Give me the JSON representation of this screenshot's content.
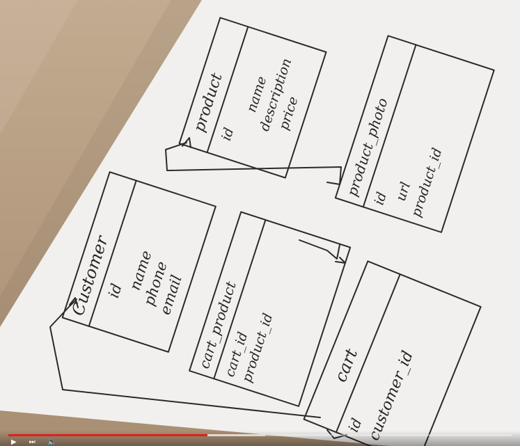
{
  "entities": {
    "product": {
      "title": "product",
      "fields": [
        "id",
        "name",
        "description",
        "price"
      ]
    },
    "product_photo": {
      "title": "product_photo",
      "fields": [
        "id",
        "url",
        "product_id"
      ]
    },
    "customer": {
      "title": "Customer",
      "fields": [
        "id",
        "name",
        "phone",
        "email"
      ]
    },
    "cart_product": {
      "title": "cart_product",
      "fields": [
        "cart_id",
        "product_id"
      ]
    },
    "cart": {
      "title": "cart",
      "fields": [
        "id",
        "customer_id"
      ]
    }
  },
  "player": {
    "progress_fraction": 0.395,
    "buffered_fraction": 0.51,
    "colors": {
      "progress": "#e11f1f"
    },
    "icons": [
      "play-icon",
      "next-icon",
      "volume-icon"
    ]
  }
}
